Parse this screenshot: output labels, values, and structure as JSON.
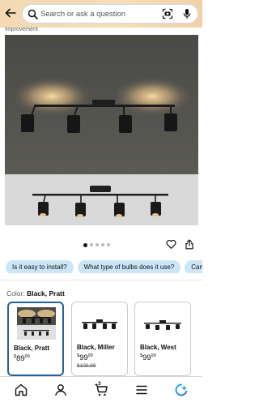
{
  "search": {
    "placeholder": "Search or ask a question"
  },
  "header": {
    "improvement_text": "Improvement"
  },
  "gallery": {
    "dot_count": 5,
    "active_index": 0
  },
  "questions": [
    "Is it easy to install?",
    "What type of bulbs does it use?",
    "Can"
  ],
  "color": {
    "label": "Color:",
    "selected": "Black, Pratt"
  },
  "swatches": [
    {
      "name": "Black, Pratt",
      "price_symbol": "$",
      "price_whole": "89",
      "price_fraction": "99",
      "list_price": ""
    },
    {
      "name": "Black, Miller",
      "price_symbol": "$",
      "price_whole": "99",
      "price_fraction": "99",
      "list_price": "$109.99"
    },
    {
      "name": "Black, West",
      "price_symbol": "$",
      "price_whole": "99",
      "price_fraction": "99",
      "list_price": ""
    }
  ],
  "nav": {
    "cart_count": "3"
  },
  "icons": [
    "back-arrow-icon",
    "search-icon",
    "camera-icon",
    "mic-icon",
    "heart-icon",
    "share-icon",
    "home-icon",
    "profile-icon",
    "cart-icon",
    "menu-icon",
    "assistant-icon"
  ],
  "colors": {
    "accent_chip": "#cce6f8",
    "selected_border": "#2162a1",
    "header_bg": "#f3d9b4"
  }
}
